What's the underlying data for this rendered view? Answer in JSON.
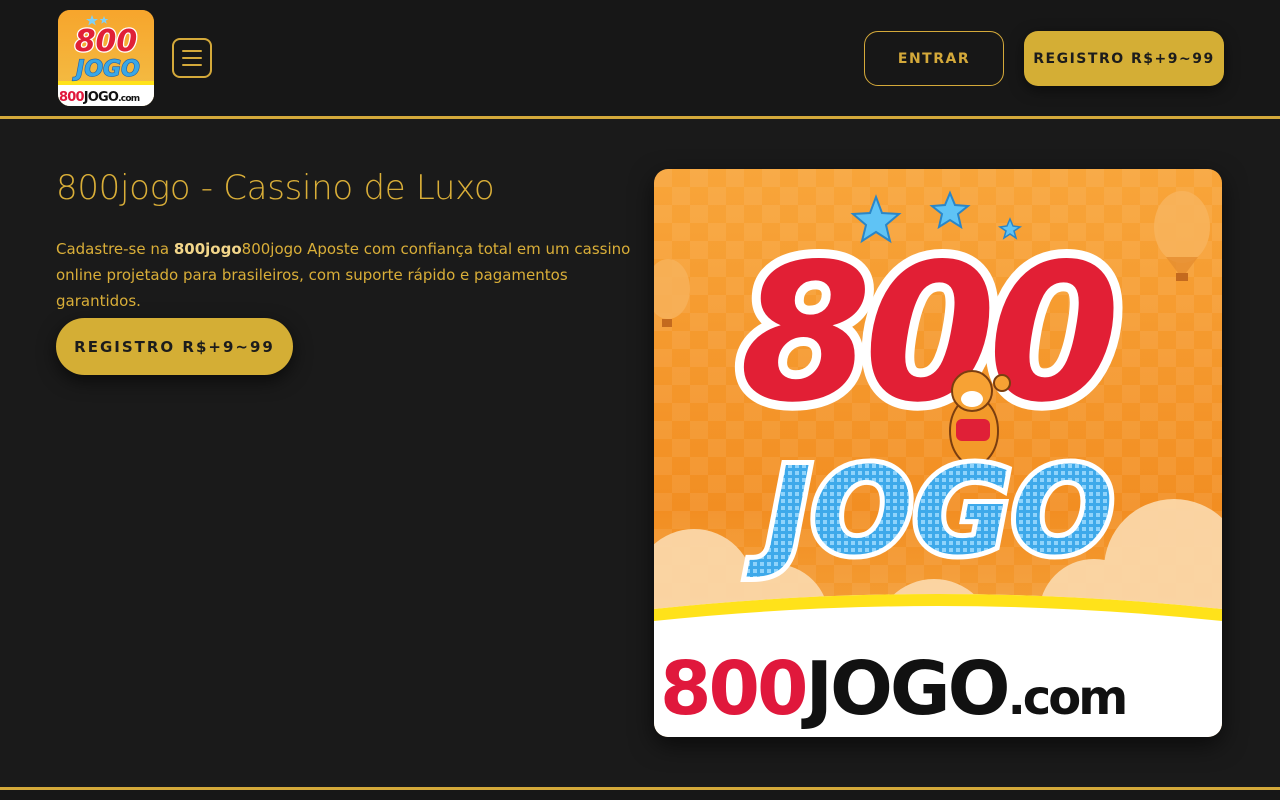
{
  "header": {
    "logo": {
      "top_text": "800",
      "middle_text": "JOGO",
      "domain_red": "800",
      "domain_black": "JOGO",
      "domain_suffix": ".com"
    },
    "menu_icon": "hamburger-menu-icon",
    "login_label": "ENTRAR",
    "register_label": "REGISTRO R$+9~99"
  },
  "main": {
    "title": "800jogo - Cassino de Luxo",
    "description": {
      "prefix": "Cadastre-se na ",
      "brand_bold": "800jogo",
      "suffix": "800jogo Aposte com confiança total em um cassino online projetado para brasileiros, com suporte rápido e pagamentos garantidos."
    },
    "cta_label": "REGISTRO R$+9~99"
  },
  "banner": {
    "top_text": "800",
    "middle_text": "JOGO",
    "domain_red": "800",
    "domain_black": "JOGO",
    "domain_suffix": ".com"
  },
  "colors": {
    "background": "#1a1a1a",
    "accent_gold": "#d4ae35",
    "text_gold": "#d9ae38",
    "brand_red": "#e02037",
    "brand_blue": "#3aa7e6",
    "banner_orange": "#f39a2a"
  }
}
